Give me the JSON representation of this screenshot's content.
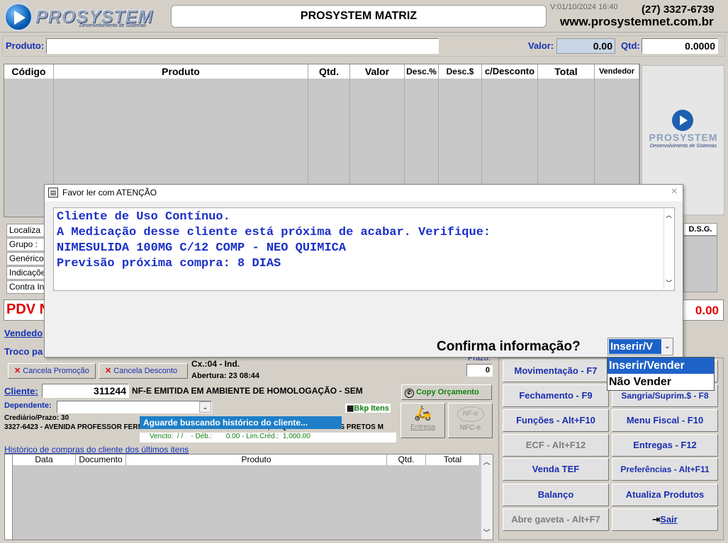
{
  "header": {
    "logo_text": "PROSYSTEM",
    "logo_sub": "Desenvolvimento de Sistemas",
    "title": "PROSYSTEM MATRIZ",
    "version": "V:01/10/2024 16:40",
    "phone": "(27) 3327-6739",
    "website": "www.prosystemnet.com.br"
  },
  "product_bar": {
    "produto_label": "Produto:",
    "produto_value": "",
    "valor_label": "Valor:",
    "valor_value": "0.00",
    "qtd_label": "Qtd:",
    "qtd_value": "0.0000"
  },
  "items_grid": {
    "columns": [
      "Código",
      "Produto",
      "Qtd.",
      "Valor",
      "Desc.%",
      "Desc.$",
      "c/Desconto",
      "Total",
      "Vendedor"
    ]
  },
  "side_logo": {
    "text": "PROSYSTEM",
    "sub": "Desenvolvimento de Sistemas"
  },
  "info_labels": [
    "Localiza",
    "Grupo :",
    "Genérico",
    "Indicaçõe",
    "Contra In"
  ],
  "dsg_label": "D.S.G.",
  "pdv": {
    "label": "PDV N",
    "total": "0.00"
  },
  "sale": {
    "vendedor_label": "Vendedo",
    "troco_label": "Troco pa",
    "cancel_promo": "Cancela Promoção",
    "cancel_desc": "Cancela Desconto",
    "caixa": "Cx.:04 - Ind.",
    "abertura": "Abertura: 23 08:44",
    "prazo_label": "Prazo:",
    "prazo_value": "0"
  },
  "cliente": {
    "label": "Cliente:",
    "code": "311244",
    "nfe_msg": "NF-E EMITIDA EM AMBIENTE DE HOMOLOGAÇÃO - SEM",
    "copy_orc": "Copy Orçamento",
    "dependente_label": "Dependente:",
    "bkp_itens": "Bkp Itens",
    "crediario": "Crediário/Prazo: 30",
    "address": "3327-6423 - AVENIDA PROFESSOR FERNANDO DUARTE RABELO 000 LOJA 2, ESQUINA DE VIDROS PRETOS M",
    "aguarde": "Aguarde buscando histórico do cliente...",
    "vencto": "Vencto:  / /    - Déb.:       0.00 - Lim.Créd.:  1,000.00",
    "entrega": "Entrega",
    "nfce": "NFC-e"
  },
  "historico": {
    "title": "Histórico de compras do cliente dos últimos itens",
    "columns": [
      "Data",
      "Documento",
      "Produto",
      "Qtd.",
      "Total"
    ]
  },
  "buttons": [
    {
      "label": "Movimentação - F7",
      "enabled": true
    },
    {
      "label": "Fechamento - F9",
      "enabled": true
    },
    {
      "label": "Sangria/Suprim.$ - F8",
      "enabled": true
    },
    {
      "label": "Funções - Alt+F10",
      "enabled": true
    },
    {
      "label": "Menu Fiscal - F10",
      "enabled": true
    },
    {
      "label": "ECF - Alt+F12",
      "enabled": false
    },
    {
      "label": "Entregas - F12",
      "enabled": true
    },
    {
      "label": "Venda TEF",
      "enabled": true
    },
    {
      "label": "Preferências - Alt+F11",
      "enabled": true
    },
    {
      "label": "Balanço",
      "enabled": true
    },
    {
      "label": "Atualiza Produtos",
      "enabled": true
    },
    {
      "label": "Abre gaveta - Alt+F7",
      "enabled": false
    },
    {
      "label": "Sair",
      "enabled": true
    }
  ],
  "dialog": {
    "title": "Favor ler com ATENÇÃO",
    "close": "×",
    "message": "Cliente de Uso Contínuo.\nA Medicação desse cliente está próxima de acabar. Verifique:\nNIMESULIDA 100MG C/12 COMP - NEO QUIMICA\nPrevisão próxima compra: 8 DIAS",
    "confirm_label": "Confirma informação?",
    "select_value": "Inserir/V",
    "options": [
      "Inserir/Vender",
      "Não Vender"
    ]
  }
}
